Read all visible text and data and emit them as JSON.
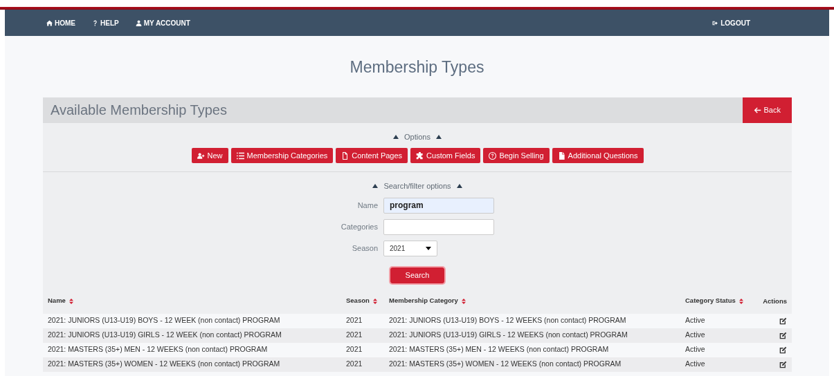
{
  "nav": {
    "items": [
      {
        "label": "HOME"
      },
      {
        "label": "HELP"
      },
      {
        "label": "MY ACCOUNT"
      }
    ],
    "logout": "LOGOUT"
  },
  "page_title": "Membership Types",
  "panel": {
    "title": "Available Membership Types",
    "back": "Back"
  },
  "options": {
    "label": "Options",
    "buttons": [
      "New",
      "Membership Categories",
      "Content Pages",
      "Custom Fields",
      "Begin Selling",
      "Additional Questions"
    ]
  },
  "search": {
    "label": "Search/filter options",
    "fields": [
      {
        "kind": "text",
        "label": "Name",
        "value": "program"
      },
      {
        "kind": "text",
        "label": "Categories"
      },
      {
        "kind": "select",
        "label": "Season",
        "value": "2021"
      }
    ],
    "button": "Search"
  },
  "table": {
    "columns": [
      {
        "label": "Name",
        "sortable": true
      },
      {
        "label": "Season",
        "sortable": true
      },
      {
        "label": "Membership Category",
        "sortable": true
      },
      {
        "label": "Category Status",
        "sortable": true
      },
      {
        "label": "Actions",
        "sortable": false
      }
    ],
    "rows": [
      {
        "name": "2021: JUNIORS (U13-U19) BOYS - 12 WEEK (non contact) PROGRAM",
        "season": "2021",
        "category": "2021: JUNIORS (U13-U19) BOYS - 12 WEEKS (non contact) PROGRAM",
        "status": "Active"
      },
      {
        "name": "2021: JUNIORS (U13-U19) GIRLS - 12 WEEK (non contact) PROGRAM",
        "season": "2021",
        "category": "2021: JUNIORS (U13-U19) GIRLS - 12 WEEKS (non contact) PROGRAM",
        "status": "Active"
      },
      {
        "name": "2021: MASTERS (35+) MEN - 12 WEEKS (non contact) PROGRAM",
        "season": "2021",
        "category": "2021: MASTERS (35+) MEN - 12 WEEKS (non contact) PROGRAM",
        "status": "Active"
      },
      {
        "name": "2021: MASTERS (35+) WOMEN - 12 WEEKS (non contact) PROGRAM",
        "season": "2021",
        "category": "2021: MASTERS (35+) WOMEN - 12 WEEKS (non contact) PROGRAM",
        "status": "Active"
      }
    ]
  }
}
